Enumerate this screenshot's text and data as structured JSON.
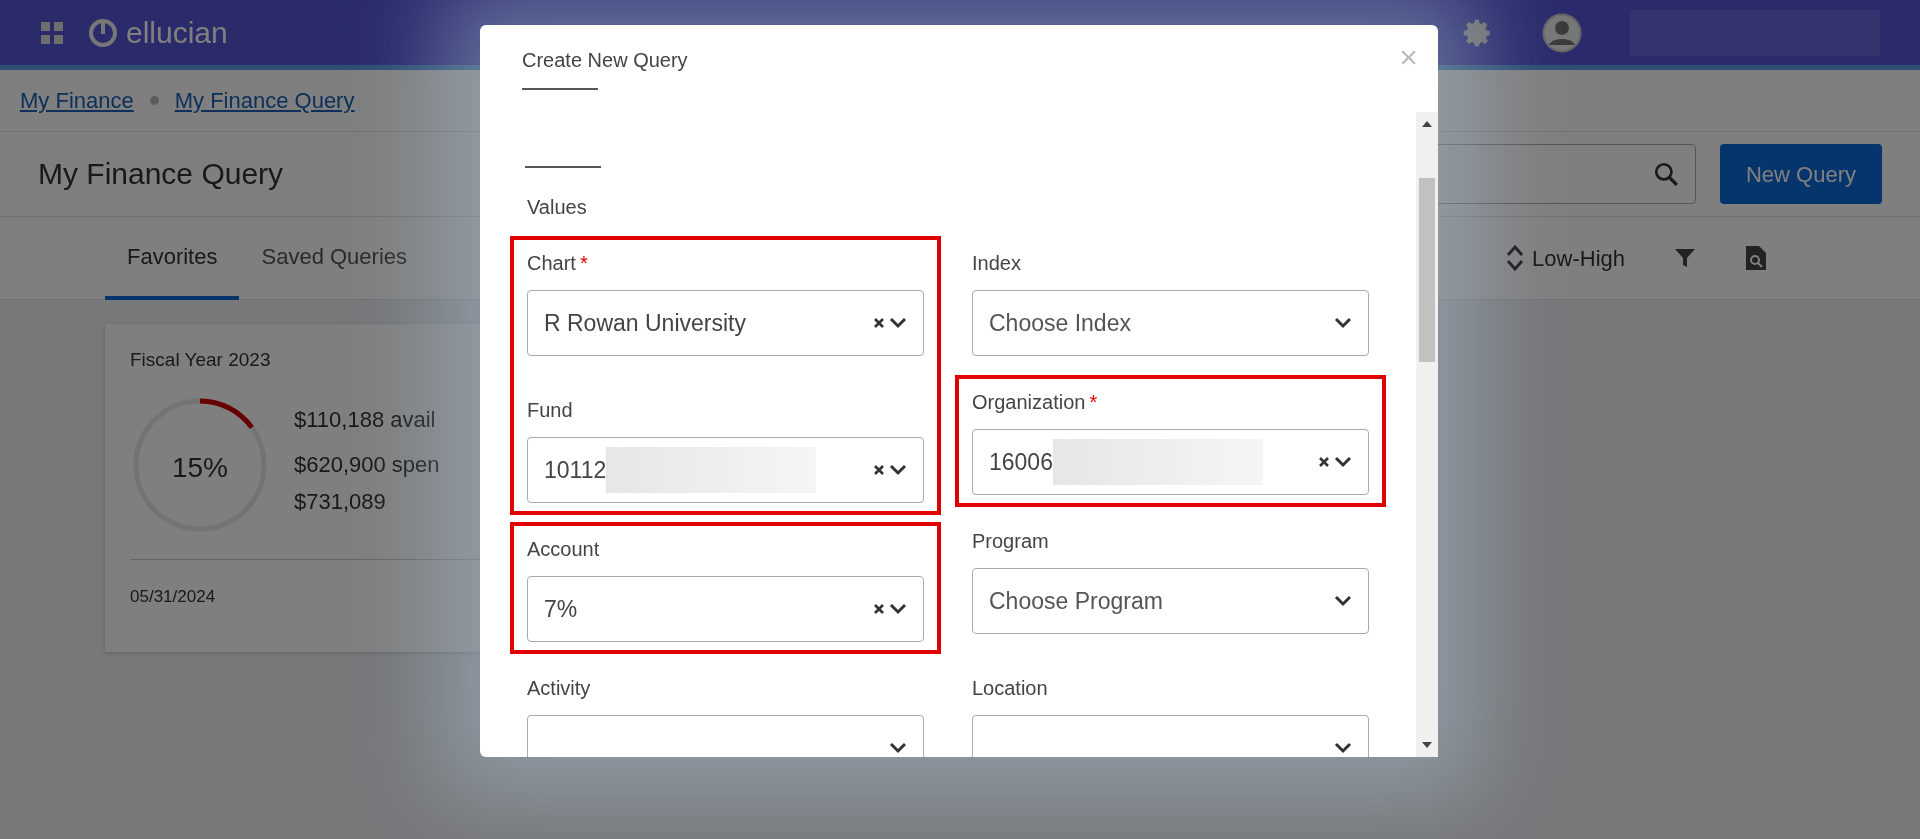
{
  "navbar": {
    "logo_text": "ellucian"
  },
  "breadcrumbs": [
    {
      "label": "My Finance"
    },
    {
      "label": "My Finance Query"
    }
  ],
  "page_title": "My Finance Query",
  "new_query_button": "New Query",
  "tabs": [
    {
      "label": "Favorites",
      "selected": true
    },
    {
      "label": "Saved Queries",
      "selected": false
    }
  ],
  "sort": {
    "label": "Low-High"
  },
  "cards": [
    {
      "title": "Fiscal Year 2023",
      "percent": "15%",
      "level": 0.15,
      "lines": [
        "$110,188 avail",
        "$620,900 spen",
        "$731,089"
      ],
      "date": "05/31/2024"
    }
  ],
  "modal": {
    "title": "Create New Query",
    "close": "×",
    "section_title": "Values",
    "columns": [
      [
        {
          "highlighted": true,
          "fields": [
            {
              "label": "Chart",
              "required_mark": "*",
              "value": "R Rowan University",
              "redacted": false,
              "clearable": true
            },
            {
              "label": "Fund",
              "value": "10112",
              "redacted": true,
              "clearable": true
            }
          ]
        },
        {
          "highlighted": true,
          "fields": [
            {
              "label": "Account",
              "value": "7%",
              "redacted": false,
              "clearable": true
            }
          ]
        },
        {
          "highlighted": false,
          "fields": [
            {
              "label": "Activity",
              "clearable": false
            }
          ]
        }
      ],
      [
        {
          "highlighted": false,
          "fields": [
            {
              "label": "Index",
              "placeholder": "Choose Index",
              "clearable": false
            }
          ]
        },
        {
          "highlighted": true,
          "fields": [
            {
              "label": "Organization",
              "required_mark": "*",
              "value": "16006",
              "redacted": true,
              "clearable": true
            }
          ]
        },
        {
          "highlighted": false,
          "fields": [
            {
              "label": "Program",
              "placeholder": "Choose Program",
              "clearable": false
            },
            {
              "label": "Location",
              "clearable": false
            }
          ]
        }
      ]
    ]
  }
}
